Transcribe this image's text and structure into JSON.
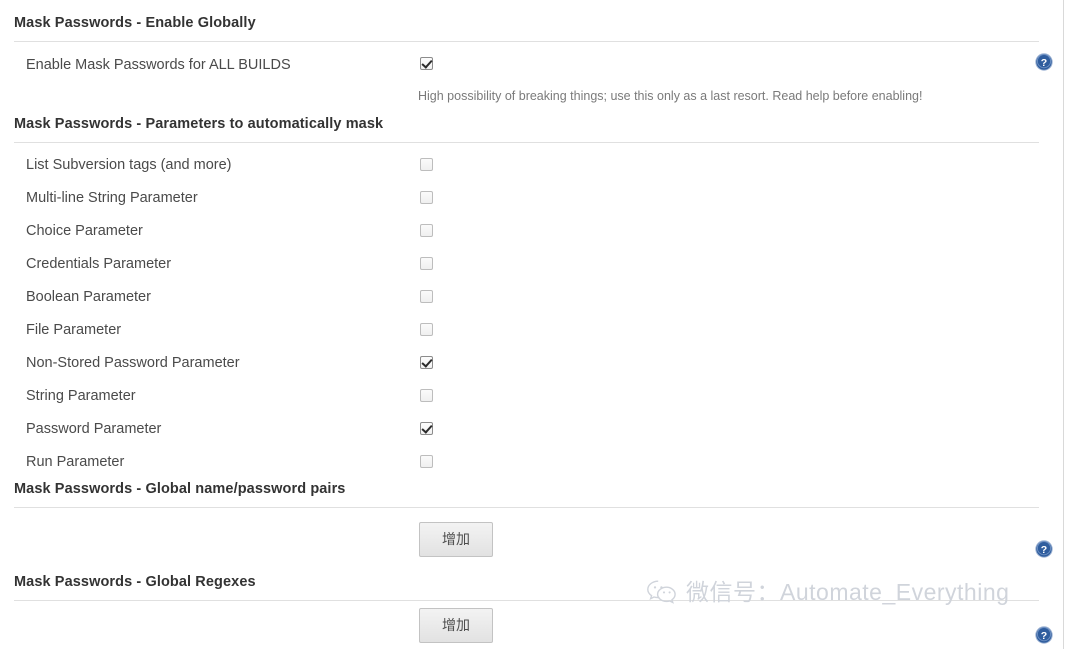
{
  "sections": [
    {
      "id": "enable-globally",
      "title": "Mask Passwords - Enable Globally",
      "rows": [
        {
          "label": "Enable Mask Passwords for ALL BUILDS",
          "checked": true,
          "hint": "High possibility of breaking things; use this only as a last resort. Read help before enabling!",
          "help": true
        }
      ]
    },
    {
      "id": "parameters-to-mask",
      "title": "Mask Passwords - Parameters to automatically mask",
      "parameters": [
        {
          "label": "List Subversion tags (and more)",
          "checked": false
        },
        {
          "label": "Multi-line String Parameter",
          "checked": false
        },
        {
          "label": "Choice Parameter",
          "checked": false
        },
        {
          "label": "Credentials Parameter",
          "checked": false
        },
        {
          "label": "Boolean Parameter",
          "checked": false
        },
        {
          "label": "File Parameter",
          "checked": false
        },
        {
          "label": "Non-Stored Password Parameter",
          "checked": true
        },
        {
          "label": "String Parameter",
          "checked": false
        },
        {
          "label": "Password Parameter",
          "checked": true
        },
        {
          "label": "Run Parameter",
          "checked": false
        }
      ]
    },
    {
      "id": "global-name-password-pairs",
      "title": "Mask Passwords - Global name/password pairs",
      "add_button": "增加",
      "help": true
    },
    {
      "id": "global-regexes",
      "title": "Mask Passwords - Global Regexes",
      "add_button": "增加",
      "help": true
    }
  ],
  "icons": {
    "help": "help-question-icon",
    "wechat": "wechat-logo-icon"
  },
  "watermark": {
    "text": "微信号：Automate_Everything"
  },
  "colors": {
    "help_icon": "#2f5d9e",
    "rule": "#e0e0e0",
    "text": "#4a4a4a",
    "hint": "#7a7a7a",
    "watermark": "#d0d4db"
  }
}
